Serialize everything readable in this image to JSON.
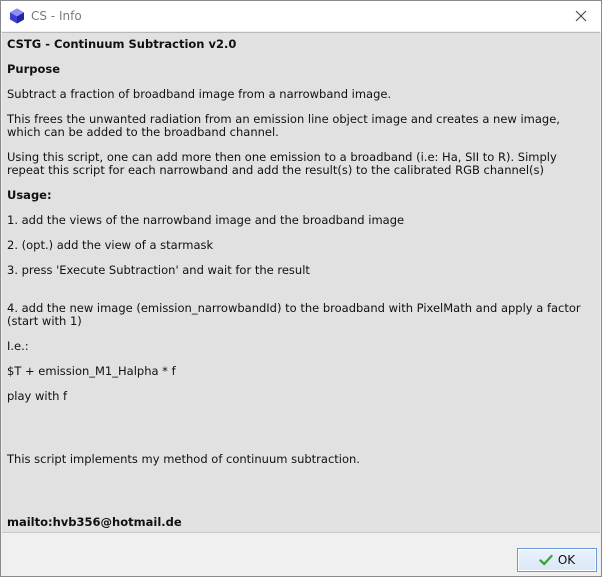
{
  "window": {
    "title": "CS - Info"
  },
  "content": {
    "heading": "CSTG - Continuum Subtraction v2.0",
    "purpose_label": "Purpose",
    "purpose_text": "Subtract a fraction of broadband image from a narrowband image.",
    "description_text": "This frees the unwanted radiation from an emission line object image and creates a new image, which can be added to the broadband channel.",
    "usage_note": "Using this script, one can add more then one emission to a broadband (i.e: Ha, SII to R). Simply repeat this script for each narrowband and add the result(s) to the calibrated RGB channel(s)",
    "usage_label": "Usage:",
    "steps": [
      "1. add the views of the narrowband image and the broadband image",
      "2. (opt.) add the view of a starmask",
      "3. press 'Execute Subtraction' and wait for the result",
      "4. add the new image (emission_narrowbandId) to the broadband with PixelMath and apply a factor (start with 1)"
    ],
    "ie_label": "I.e.:",
    "formula": "$T + emission_M1_Halpha * f",
    "play_text": "play with f",
    "method_text": "This script implements my method of continuum subtraction.",
    "mailto": "mailto:hvb356@hotmail.de"
  },
  "buttons": {
    "ok_label": "OK"
  },
  "icons": {
    "app": "pixinsight-cube-icon",
    "close": "close-icon",
    "ok": "checkmark-icon"
  },
  "colors": {
    "content_bg": "#e1e1e1",
    "ok_border": "#6a98d8",
    "check_green": "#3aa53a"
  }
}
